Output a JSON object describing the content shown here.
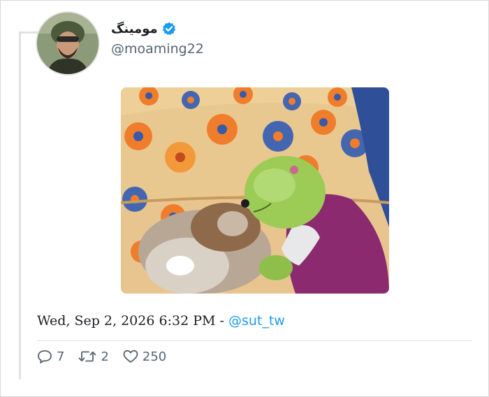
{
  "tweet": {
    "display_name": "مومینگ",
    "handle": "@moaming22",
    "timestamp": "Wed, Sep 2, 2026 6:32 PM",
    "separator": " - ",
    "via_handle": "@sut_tw",
    "media_description_icon": "video-still"
  },
  "actions": {
    "replies": "7",
    "retweets": "2",
    "likes": "250"
  },
  "colors": {
    "link": "#1d9bf0",
    "verified": "#1d9bf0",
    "muted": "#536471",
    "border": "#d9d9d9"
  }
}
